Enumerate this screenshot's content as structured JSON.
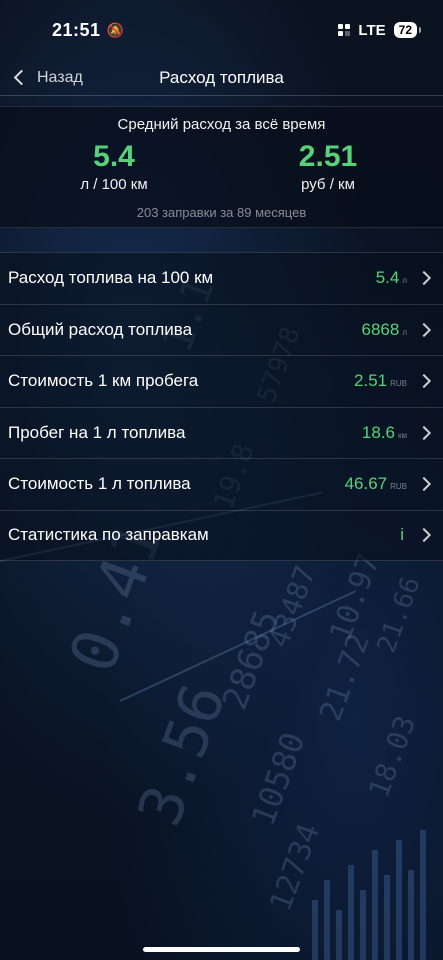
{
  "status": {
    "time": "21:51",
    "network": "LTE",
    "battery": "72"
  },
  "nav": {
    "back_label": "Назад",
    "title": "Расход топлива"
  },
  "summary": {
    "title": "Средний расход за всё время",
    "left_value": "5.4",
    "left_unit": "л / 100 км",
    "right_value": "2.51",
    "right_unit": "руб / км",
    "note": "203 заправки за 89 месяцев"
  },
  "rows": [
    {
      "label": "Расход топлива на 100 км",
      "value": "5.4",
      "unit": "л"
    },
    {
      "label": "Общий расход топлива",
      "value": "6868",
      "unit": "л"
    },
    {
      "label": "Стоимость 1 км пробега",
      "value": "2.51",
      "unit": "RUB"
    },
    {
      "label": "Пробег на 1 л топлива",
      "value": "18.6",
      "unit": "км"
    },
    {
      "label": "Стоимость 1 л топлива",
      "value": "46.67",
      "unit": "RUB"
    },
    {
      "label": "Статистика по заправкам",
      "value": "i",
      "unit": ""
    }
  ],
  "colors": {
    "accent_green": "#57d27b",
    "background": "#070b14"
  }
}
